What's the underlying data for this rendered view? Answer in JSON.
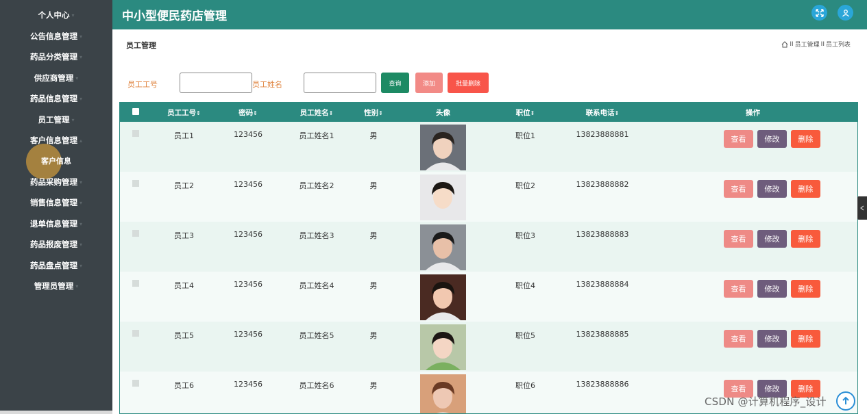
{
  "app": {
    "title": "中小型便民药店管理"
  },
  "sidebar": {
    "items": [
      {
        "label": "个人中心"
      },
      {
        "label": "公告信息管理"
      },
      {
        "label": "药品分类管理"
      },
      {
        "label": "供应商管理"
      },
      {
        "label": "药品信息管理"
      },
      {
        "label": "员工管理"
      },
      {
        "label": "客户信息管理"
      },
      {
        "label": "客户信息"
      },
      {
        "label": "药品采购管理"
      },
      {
        "label": "销售信息管理"
      },
      {
        "label": "退单信息管理"
      },
      {
        "label": "药品报废管理"
      },
      {
        "label": "药品盘点管理"
      },
      {
        "label": "管理员管理"
      }
    ]
  },
  "page": {
    "title": "员工管理",
    "breadcrumb": [
      "员工管理",
      "员工列表"
    ],
    "breadcrumb_sep": "II"
  },
  "search": {
    "label_id": "员工工号",
    "label_name": "员工姓名",
    "value_id": "",
    "value_name": "",
    "query_label": "查询",
    "add_label": "添加",
    "batch_delete_label": "批量删除"
  },
  "table": {
    "columns": [
      "员工工号",
      "密码",
      "员工姓名",
      "性别",
      "头像",
      "职位",
      "联系电话",
      "操作"
    ],
    "sortable": [
      true,
      true,
      true,
      true,
      false,
      true,
      true,
      false
    ],
    "sort_icon": "⇕",
    "actions": {
      "view": "查看",
      "edit": "修改",
      "delete": "删除"
    },
    "rows": [
      {
        "id": "员工1",
        "password": "123456",
        "name": "员工姓名1",
        "gender": "男",
        "position": "职位1",
        "phone": "13823888881"
      },
      {
        "id": "员工2",
        "password": "123456",
        "name": "员工姓名2",
        "gender": "男",
        "position": "职位2",
        "phone": "13823888882"
      },
      {
        "id": "员工3",
        "password": "123456",
        "name": "员工姓名3",
        "gender": "男",
        "position": "职位3",
        "phone": "13823888883"
      },
      {
        "id": "员工4",
        "password": "123456",
        "name": "员工姓名4",
        "gender": "男",
        "position": "职位4",
        "phone": "13823888884"
      },
      {
        "id": "员工5",
        "password": "123456",
        "name": "员工姓名5",
        "gender": "男",
        "position": "职位5",
        "phone": "13823888885"
      },
      {
        "id": "员工6",
        "password": "123456",
        "name": "员工姓名6",
        "gender": "男",
        "position": "职位6",
        "phone": "13823888886"
      }
    ]
  },
  "watermark": "CSDN @计算机程序_设计",
  "colors": {
    "sidebar_bg": "#3b4348",
    "header_bg": "#2b8a80",
    "query_button": "#1d8a64",
    "add_button": "#f28a86",
    "batch_delete_button": "#f8554a",
    "label_text": "#e0833e"
  },
  "icons": {
    "fullscreen": "fullscreen-icon",
    "user": "user-icon",
    "home": "home-icon",
    "scroll_top": "arrow-up-icon",
    "collapse": "chevron-left-icon"
  }
}
